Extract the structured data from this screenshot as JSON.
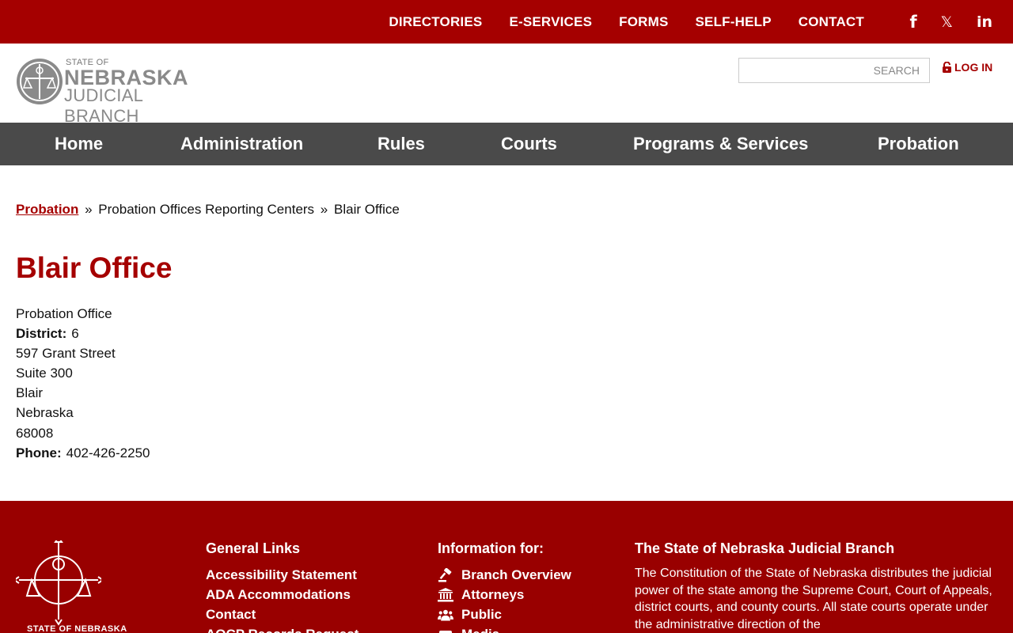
{
  "topnav": {
    "links": [
      "DIRECTORIES",
      "E-SERVICES",
      "FORMS",
      "SELF-HELP",
      "CONTACT"
    ],
    "social": [
      "facebook-icon",
      "x-icon",
      "linkedin-icon"
    ]
  },
  "header": {
    "logo": {
      "line1": "STATE OF",
      "line2": "NEBRASKA",
      "line3": "JUDICIAL BRANCH"
    },
    "search_placeholder": "SEARCH",
    "login_label": "LOG IN"
  },
  "mainnav": [
    "Home",
    "Administration",
    "Rules",
    "Courts",
    "Programs & Services",
    "Probation"
  ],
  "breadcrumb": {
    "link": "Probation",
    "separator": "»",
    "middle": "Probation Offices Reporting Centers",
    "current": "Blair Office"
  },
  "page": {
    "title": "Blair Office",
    "type": "Probation Office",
    "district_label": "District:",
    "district": "6",
    "street": "597 Grant Street",
    "suite": "Suite 300",
    "city": "Blair",
    "state": "Nebraska",
    "zip": "68008",
    "phone_label": "Phone:",
    "phone": "402-426-2250"
  },
  "footer": {
    "seal_text": "STATE OF NEBRASKA",
    "general_title": "General Links",
    "general_links": [
      "Accessibility Statement",
      "ADA Accommodations",
      "Contact",
      "AOCP Records Request"
    ],
    "info_title": "Information for:",
    "info_links": [
      "Branch Overview",
      "Attorneys",
      "Public",
      "Media"
    ],
    "about_title": "The State of Nebraska Judicial Branch",
    "about_text": "The Constitution of the State of Nebraska distributes the judicial power of the state among the Supreme Court, Court of Appeals, district courts, and county courts.  All state courts operate under the administrative direction of the"
  },
  "colors": {
    "brand_red": "#a50000",
    "nav_gray": "#4a4a4a",
    "footer_red": "#990000"
  }
}
